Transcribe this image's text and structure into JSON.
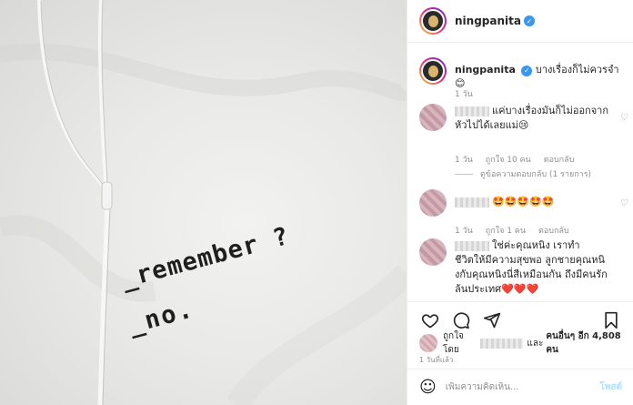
{
  "post": {
    "username": "ningpanita",
    "verified_mark": "✓",
    "caption": "บางเรื่องก็ไม่ควรจำ 😊",
    "caption_time": "1 วัน",
    "shirt_text_line1": "_remember ?",
    "shirt_text_line2": "_no."
  },
  "comments": [
    {
      "text_line1": "แค่บางเรื่องมันก็ไม่ออกจาก",
      "text_line2": "หัวไปได้เลยแม่😢",
      "time": "1 วัน",
      "likes": "ถูกใจ 10 คน",
      "reply": "ตอบกลับ"
    },
    {
      "text_line1": "🤩🤩🤩🤩🤩",
      "time": "1 วัน",
      "likes": "ถูกใจ 1 คน",
      "reply": "ตอบกลับ"
    },
    {
      "text_line1": "ใช่ค่ะคุณหนิง เราทำ",
      "text_line2": "ชีวิตให้มีความสุขพอ ลูกชายคุณหนิ",
      "text_line3": "งกับคุณหนิงนี่สีเหมือนกัน ถึงมีคนรัก",
      "text_line4": "ล้นประเทศ",
      "hearts": "❤️❤️❤️"
    }
  ],
  "view_replies": "ดูข้อความตอบกลับ (1 รายการ)",
  "likes_summary": {
    "prefix": "ถูกใจโดย",
    "and": "และ",
    "others": "คนอื่นๆ อีก 4,808 คน"
  },
  "post_date": "1 วันที่แล้ว",
  "add_comment": {
    "placeholder": "เพิ่มความคิดเห็น...",
    "post_label": "โพสต์"
  },
  "icons": {
    "like": "heart-outline",
    "comment": "speech-bubble",
    "share": "paper-plane",
    "save": "bookmark",
    "emoji": "smiley-face"
  },
  "colors": {
    "verified": "#3897f0",
    "post_button_disabled": "#b2dffc",
    "meta_text": "#8e8e8e"
  }
}
